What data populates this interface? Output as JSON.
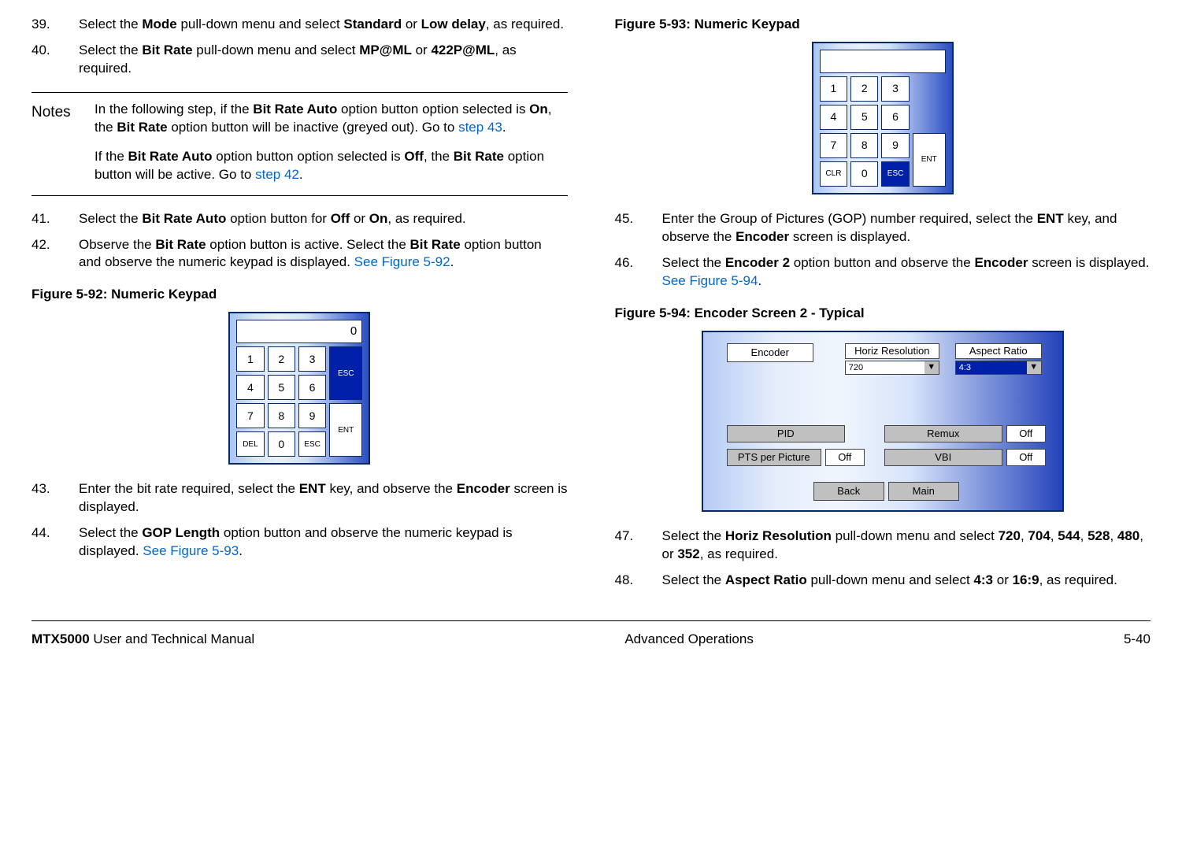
{
  "left": {
    "steps": {
      "s39": {
        "num": "39.",
        "t1": "Select the ",
        "b1": "Mode",
        "t2": " pull-down menu and select ",
        "b2": "Standard",
        "t3": " or ",
        "b3": "Low delay",
        "t4": ", as required."
      },
      "s40": {
        "num": "40.",
        "t1": "Select the ",
        "b1": "Bit Rate",
        "t2": " pull-down menu and select ",
        "b2": "MP@ML",
        "t3": " or ",
        "b3": "422P@ML",
        "t4": ", as required."
      },
      "s41": {
        "num": "41.",
        "t1": "Select the ",
        "b1": "Bit Rate Auto",
        "t2": " option button for ",
        "b2": "Off",
        "t3": " or ",
        "b3": "On",
        "t4": ", as required."
      },
      "s42": {
        "num": "42.",
        "t1": "Observe the ",
        "b1": "Bit Rate",
        "t2": " option button is active.  Select the ",
        "b2": "Bit Rate",
        "t3": " option button and observe the numeric keypad is displayed.  ",
        "link": "See Figure 5-92",
        "t4": "."
      },
      "s43": {
        "num": "43.",
        "t1": "Enter the bit rate required, select the ",
        "b1": "ENT",
        "t2": " key, and observe the ",
        "b2": "Encoder",
        "t3": " screen is displayed."
      },
      "s44": {
        "num": "44.",
        "t1": "Select the ",
        "b1": "GOP Length",
        "t2": " option button and observe the numeric keypad is displayed.  ",
        "link": "See Figure 5-93",
        "t3": "."
      }
    },
    "notes": {
      "label": "Notes",
      "p1": {
        "t1": "In the following step, if the ",
        "b1": "Bit Rate Auto",
        "t2": " option button option selected is ",
        "b2": "On",
        "t3": ", the ",
        "b3": "Bit Rate",
        "t4": " option button will be inactive (greyed out).  Go to ",
        "link": "step 43",
        "t5": "."
      },
      "p2": {
        "t1": "If the ",
        "b1": "Bit Rate Auto",
        "t2": " option button option selected is ",
        "b2": "Off",
        "t3": ", the ",
        "b3": "Bit Rate",
        "t4": " option button will be active.  Go to ",
        "link": "step 42",
        "t5": "."
      }
    },
    "fig92": {
      "title": "Figure 5-92:   Numeric Keypad",
      "display": "0",
      "keys": {
        "k1": "1",
        "k2": "2",
        "k3": "3",
        "k4": "4",
        "k5": "5",
        "k6": "6",
        "k7": "7",
        "k8": "8",
        "k9": "9",
        "k0": "0",
        "del": "DEL",
        "esc": "ESC",
        "escBig": "ESC",
        "ent": "ENT"
      }
    }
  },
  "right": {
    "fig93": {
      "title": "Figure 5-93:   Numeric Keypad",
      "display": "",
      "keys": {
        "k1": "1",
        "k2": "2",
        "k3": "3",
        "k4": "4",
        "k5": "5",
        "k6": "6",
        "k7": "7",
        "k8": "8",
        "k9": "9",
        "k0": "0",
        "clr": "CLR",
        "esc": "ESC",
        "ent": "ENT"
      }
    },
    "steps": {
      "s45": {
        "num": "45.",
        "t1": "Enter the Group of Pictures (GOP) number required, select the ",
        "b1": "ENT",
        "t2": " key, and observe the ",
        "b2": "Encoder",
        "t3": " screen is displayed."
      },
      "s46": {
        "num": "46.",
        "t1": "Select the ",
        "b1": "Encoder 2",
        "t2": " option button and observe the ",
        "b2": "Encoder",
        "t3": " screen is displayed.  ",
        "link": "See Figure 5-94",
        "t4": "."
      },
      "s47": {
        "num": "47.",
        "t1": "Select the ",
        "b1": "Horiz Resolution",
        "t2": " pull-down menu and select ",
        "b2": "720",
        "c": ", ",
        "b3": "704",
        "b4": "544",
        "b5": "528",
        "b6": "480",
        "t3": ", or ",
        "b7": "352",
        "t4": ", as required."
      },
      "s48": {
        "num": "48.",
        "t1": "Select the ",
        "b1": "Aspect Ratio",
        "t2": " pull-down menu and select ",
        "b2": "4:3",
        "t3": " or ",
        "b3": "16:9",
        "t4": ", as required."
      }
    },
    "fig94": {
      "title": "Figure 5-94:   Encoder Screen 2 - Typical",
      "encoder": "Encoder",
      "horiz": "Horiz Resolution",
      "horizVal": "720",
      "aspect": "Aspect Ratio",
      "aspectVal": "4:3",
      "pid": "PID",
      "remux": "Remux",
      "remuxVal": "Off",
      "pts": "PTS per Picture",
      "ptsVal": "Off",
      "vbi": "VBI",
      "vbiVal": "Off",
      "back": "Back",
      "main": "Main",
      "arrow": "▼"
    }
  },
  "footer": {
    "left_b": "MTX5000",
    "left_t": " User and Technical Manual",
    "center": "Advanced Operations",
    "right": "5-40"
  }
}
